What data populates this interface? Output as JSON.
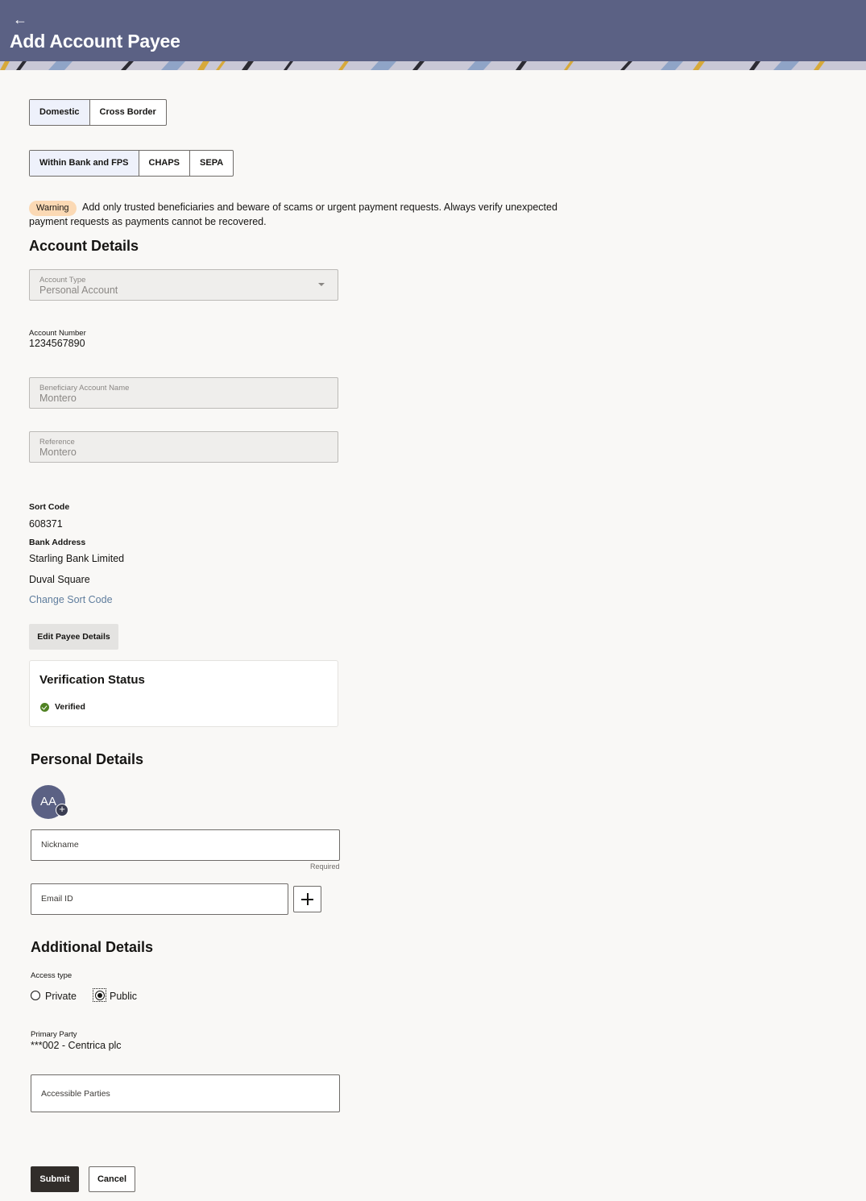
{
  "header": {
    "title": "Add Account Payee",
    "back_icon": "back-arrow-icon"
  },
  "payee_region_tabs": [
    "Domestic",
    "Cross Border"
  ],
  "payment_network_tabs": [
    "Within Bank and FPS",
    "CHAPS",
    "SEPA"
  ],
  "warning": {
    "badge": "Warning",
    "text": "Add only trusted beneficiaries and beware of scams or urgent payment requests. Always verify unexpected payment requests as payments cannot be recovered."
  },
  "account_details": {
    "heading": "Account Details",
    "account_type": {
      "label": "Account Type",
      "value": "Personal Account"
    },
    "account_number": {
      "label": "Account Number",
      "value": "1234567890"
    },
    "beneficiary_name": {
      "label": "Beneficiary Account Name",
      "value": "Montero"
    },
    "reference": {
      "label": "Reference",
      "value": "Montero"
    },
    "sort_code": {
      "label": "Sort Code",
      "value": "608371"
    },
    "bank_address": {
      "label": "Bank Address",
      "line1": "Starling Bank Limited",
      "line2": "Duval Square"
    },
    "change_sort_code": "Change Sort Code",
    "edit_button": "Edit Payee Details"
  },
  "verification": {
    "title": "Verification Status",
    "status": "Verified",
    "status_color": "#508223"
  },
  "personal_details": {
    "heading": "Personal Details",
    "avatar_initials": "AA",
    "nickname_placeholder": "Nickname",
    "required_hint": "Required",
    "email_placeholder": "Email ID"
  },
  "additional_details": {
    "heading": "Additional Details",
    "access_type_label": "Access type",
    "access_options": [
      "Private",
      "Public"
    ],
    "access_selected": "Public",
    "primary_party_label": "Primary Party",
    "primary_party_value": "***002 - Centrica plc",
    "accessible_parties_placeholder": "Accessible Parties"
  },
  "actions": {
    "submit": "Submit",
    "cancel": "Cancel"
  },
  "colors": {
    "header": "#5b6184",
    "submit": "#312d2a",
    "link": "#5f7d9d",
    "warning_badge": "#fbd9b4"
  }
}
